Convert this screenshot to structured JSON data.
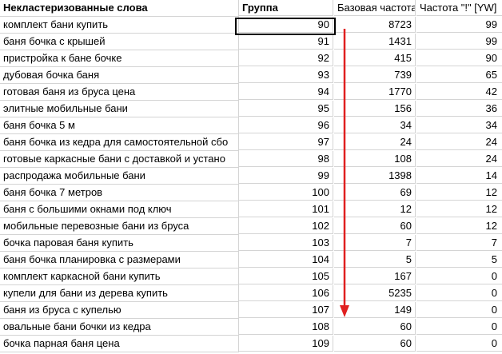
{
  "headers": {
    "keyword": "Неклaстеризованные слова",
    "group": "Группа",
    "base_freq": "Базовая частота",
    "exact_freq": "Частота \"!\" [YW]"
  },
  "rows": [
    {
      "keyword": "комплект бани купить",
      "group": "90",
      "base": "8723",
      "exact": "99"
    },
    {
      "keyword": "баня бочка с крышей",
      "group": "91",
      "base": "1431",
      "exact": "99"
    },
    {
      "keyword": "пристройка к бане бочке",
      "group": "92",
      "base": "415",
      "exact": "90"
    },
    {
      "keyword": "дубовая бочка баня",
      "group": "93",
      "base": "739",
      "exact": "65"
    },
    {
      "keyword": "готовая баня из бруса цена",
      "group": "94",
      "base": "1770",
      "exact": "42"
    },
    {
      "keyword": "элитные мобильные бани",
      "group": "95",
      "base": "156",
      "exact": "36"
    },
    {
      "keyword": "баня бочка 5 м",
      "group": "96",
      "base": "34",
      "exact": "34"
    },
    {
      "keyword": "баня бочка из кедра для самостоятельной сбо",
      "group": "97",
      "base": "24",
      "exact": "24"
    },
    {
      "keyword": "готовые каркасные бани с доставкой и устано",
      "group": "98",
      "base": "108",
      "exact": "24"
    },
    {
      "keyword": "распродажа мобильные бани",
      "group": "99",
      "base": "1398",
      "exact": "14"
    },
    {
      "keyword": "баня бочка 7 метров",
      "group": "100",
      "base": "69",
      "exact": "12"
    },
    {
      "keyword": "баня с большими окнами под ключ",
      "group": "101",
      "base": "12",
      "exact": "12"
    },
    {
      "keyword": "мобильные перевозные бани из бруса",
      "group": "102",
      "base": "60",
      "exact": "12"
    },
    {
      "keyword": "бочка паровая баня купить",
      "group": "103",
      "base": "7",
      "exact": "7"
    },
    {
      "keyword": "баня бочка планировка с размерами",
      "group": "104",
      "base": "5",
      "exact": "5"
    },
    {
      "keyword": "комплект каркасной бани купить",
      "group": "105",
      "base": "167",
      "exact": "0"
    },
    {
      "keyword": "купели для бани из дерева купить",
      "group": "106",
      "base": "5235",
      "exact": "0"
    },
    {
      "keyword": "баня из бруса с купелью",
      "group": "107",
      "base": "149",
      "exact": "0"
    },
    {
      "keyword": "овальные бани бочки из кедра",
      "group": "108",
      "base": "60",
      "exact": "0"
    },
    {
      "keyword": "бочка парная баня цена",
      "group": "109",
      "base": "60",
      "exact": "0"
    }
  ],
  "selected_cell": "group-row-1",
  "annotation": {
    "type": "arrow",
    "direction": "down",
    "color": "#e02020"
  }
}
